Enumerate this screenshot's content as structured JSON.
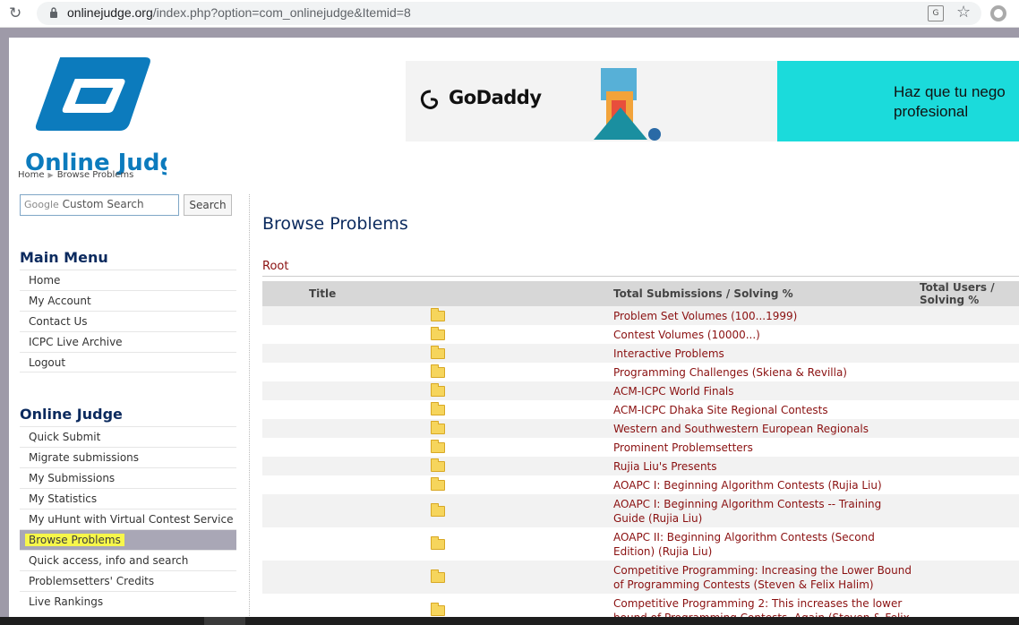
{
  "browser": {
    "url_host": "onlinejudge.org",
    "url_rest": "/index.php?option=com_onlinejudge&Itemid=8"
  },
  "header": {
    "logo_text": "Online Judge",
    "breadcrumb": [
      "Home",
      "Browse Problems"
    ]
  },
  "ad": {
    "brand": "GoDaddy",
    "line1": "Haz que tu nego",
    "line2": "profesional"
  },
  "sidebar": {
    "search_placeholder": "Custom Search",
    "search_brand": "Google",
    "search_button": "Search",
    "main_menu_title": "Main Menu",
    "main_menu": [
      "Home",
      "My Account",
      "Contact Us",
      "ICPC Live Archive",
      "Logout"
    ],
    "oj_menu_title": "Online Judge",
    "oj_menu": [
      "Quick Submit",
      "Migrate submissions",
      "My Submissions",
      "My Statistics",
      "My uHunt with Virtual Contest Service",
      "Browse Problems",
      "Quick access, info and search",
      "Problemsetters' Credits",
      "Live Rankings"
    ],
    "active_item": "Browse Problems"
  },
  "content": {
    "title": "Browse Problems",
    "root": "Root",
    "columns": [
      "Title",
      "Total Submissions / Solving %",
      "Total Users / Solving %"
    ],
    "rows": [
      [
        "Problem Set Volumes (100...1999)"
      ],
      [
        "Contest Volumes (10000...)"
      ],
      [
        "Interactive Problems"
      ],
      [
        "Programming Challenges (Skiena & Revilla)"
      ],
      [
        "ACM-ICPC World Finals"
      ],
      [
        "ACM-ICPC Dhaka Site Regional Contests"
      ],
      [
        "Western and Southwestern European Regionals"
      ],
      [
        "Prominent Problemsetters"
      ],
      [
        "Rujia Liu's Presents"
      ],
      [
        "AOAPC I: Beginning Algorithm Contests (Rujia Liu)"
      ],
      [
        "AOAPC I: Beginning Algorithm Contests -- Training",
        "Guide (Rujia Liu)"
      ],
      [
        "AOAPC II: Beginning Algorithm Contests (Second",
        "Edition) (Rujia Liu)"
      ],
      [
        "Competitive Programming: Increasing the Lower Bound",
        "of Programming Contests (Steven & Felix Halim)"
      ],
      [
        "Competitive Programming 2: This increases the lower",
        "bound of Programming Contests. Again (Steven & Felix"
      ]
    ]
  }
}
